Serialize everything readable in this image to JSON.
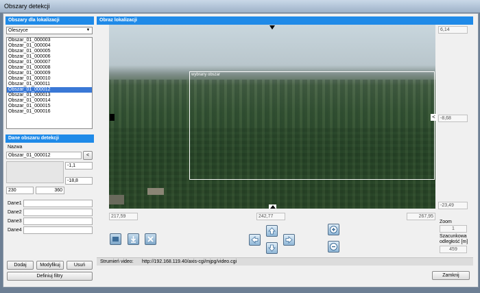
{
  "window": {
    "title": "Obszary detekcji"
  },
  "left": {
    "areas_header": "Obszary dla lokalizacji",
    "location_select": "Oleszyce",
    "areas": [
      "Obszar_01_000003",
      "Obszar_01_000004",
      "Obszar_01_000005",
      "Obszar_01_000006",
      "Obszar_01_000007",
      "Obszar_01_000008",
      "Obszar_01_000009",
      "Obszar_01_000010",
      "Obszar_01_000011",
      "Obszar_01_000012",
      "Obszar_01_000013",
      "Obszar_01_000014",
      "Obszar_01_000015",
      "Obszar_01_000016"
    ],
    "selected_area": "Obszar_01_000012",
    "detail_header": "Dane obszaru detekcji",
    "name_label": "Nazwa",
    "name_value": "Obszar_01_000012",
    "name_button": "<",
    "coord_top": "-1,1",
    "coord_bottom": "-18,8",
    "coord_left": "230",
    "coord_right": "360",
    "dane": [
      {
        "label": "Dane1",
        "value": ""
      },
      {
        "label": "Dane2",
        "value": ""
      },
      {
        "label": "Dane3",
        "value": ""
      },
      {
        "label": "Dane4",
        "value": ""
      }
    ],
    "buttons": {
      "add": "Dodaj",
      "modify": "Modyfikuj",
      "delete": "Usuń",
      "filters": "Definiuj filtry"
    }
  },
  "right": {
    "header": "Obraz lokalizacji",
    "overlay_label": "wybrany obszar",
    "right_scale": {
      "top": "6,14",
      "middle": "-8,68",
      "bottom": "-23,49"
    },
    "bottom_scale": {
      "left": "217,59",
      "middle": "242,77",
      "right": "267,95"
    },
    "right_marker": "<",
    "zoom_label": "Zoom",
    "zoom_value": "1",
    "distance_label": "Szacunkowa odległość [m]",
    "distance_value": "459",
    "stream_label": "Strumień video:",
    "stream_url": "http://192.168.119.40/axis-cgi/mjpg/video.cgi",
    "close_button": "Zamknij"
  },
  "colors": {
    "header_blue": "#1f8ae8",
    "selection": "#3a78d6"
  },
  "icons": [
    "square-icon",
    "download-icon",
    "delete-x-icon",
    "arrow-up-icon",
    "arrow-left-icon",
    "arrow-down-icon",
    "arrow-right-icon",
    "zoom-in-icon",
    "zoom-out-icon"
  ]
}
